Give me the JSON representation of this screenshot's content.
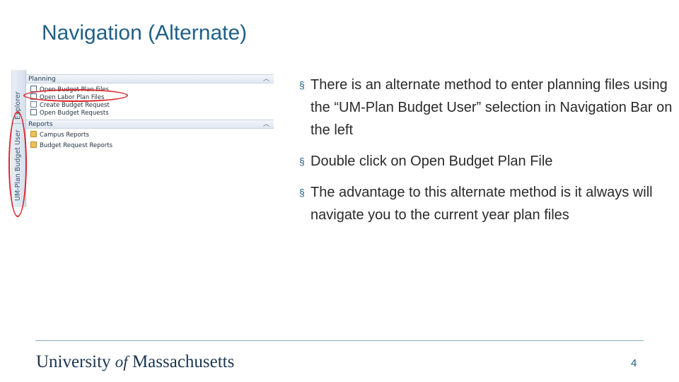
{
  "slide": {
    "title": "Navigation (Alternate)",
    "page_number": "4",
    "footer": {
      "university": "University",
      "of": "of",
      "massachusetts": "Massachusetts"
    }
  },
  "screenshot": {
    "sidebar_tabs": [
      "Explorer",
      "UM-Plan Budget User"
    ],
    "sections": [
      {
        "header": "Planning",
        "items": [
          {
            "label": "Open Budget Plan Files",
            "icon": "file-icon"
          },
          {
            "label": "Open Labor Plan Files",
            "icon": "file-icon"
          },
          {
            "label": "Create Budget Request",
            "icon": "document-icon"
          },
          {
            "label": "Open Budget Requests",
            "icon": "file-icon"
          }
        ]
      },
      {
        "header": "Reports",
        "items": [
          {
            "label": "Campus Reports",
            "icon": "folder-icon"
          },
          {
            "label": "Budget Request Reports",
            "icon": "folder-icon"
          }
        ]
      }
    ],
    "highlight_color": "#d9262a"
  },
  "bullets": [
    "There is an alternate method to enter planning files using the “UM-Plan Budget User” selection in Navigation Bar on the left",
    "Double click on Open Budget Plan File",
    "The advantage to this alternate method is it always will navigate you to the current year plan files"
  ],
  "colors": {
    "title": "#1f5f86",
    "text": "#2a2a2a"
  }
}
